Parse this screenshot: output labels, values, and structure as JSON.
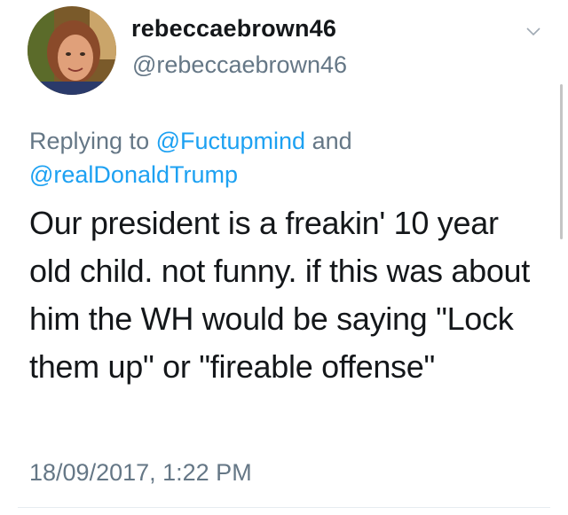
{
  "user": {
    "display_name": "rebeccaebrown46",
    "handle": "@rebeccaebrown46"
  },
  "reply": {
    "prefix": "Replying to ",
    "mention_1": "@Fuctupmind",
    "conjunction": " and ",
    "mention_2": "@realDonaldTrump"
  },
  "tweet": {
    "text": "Our president is a freakin' 10 year old child. not funny. if this was about him the WH would be saying \"Lock them up\" or \"fireable offense\"",
    "timestamp": "18/09/2017, 1:22 PM"
  },
  "icons": {
    "menu": "chevron-down-icon"
  },
  "colors": {
    "text": "#14171a",
    "muted": "#657786",
    "link": "#1da1f2"
  }
}
